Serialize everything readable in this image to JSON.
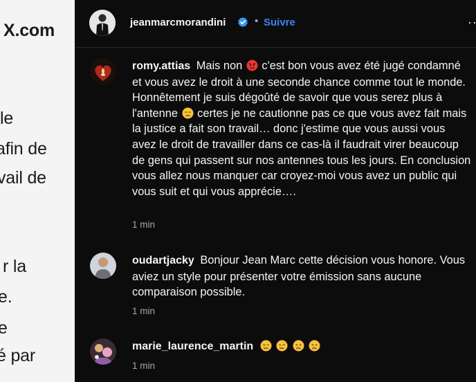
{
  "post_fragments": [
    "X.com",
    "le",
    "afin de",
    "vail de",
    "r la",
    "e.",
    "e",
    "é par"
  ],
  "header": {
    "username": "jeanmarcmorandini",
    "separator": "•",
    "follow_label": "Suivre",
    "more_label": "···"
  },
  "comments": [
    {
      "username": "romy.attias",
      "text_before_emoji": "Mais non",
      "text_after_emoji": "c'est bon vous avez été jugé condamné et vous avez le droit à une seconde chance comme tout le monde. Honnêtement je suis dégoûté de savoir que vous serez plus à l'antenne",
      "text_end": "certes je ne cautionne pas ce que vous avez fait mais la justice a fait son travail… donc j'estime que vous aussi vous avez le droit de travailler dans ce cas-là il faudrait virer beaucoup de gens qui passent sur nos antennes tous les jours. En conclusion vous allez nous manquer car croyez-moi vous avez un public qui vous suit et qui vous apprécie….",
      "time": "1 min"
    },
    {
      "username": "oudartjacky",
      "text": "Bonjour Jean Marc cette décision vous honore. Vous aviez un style pour présenter votre émission sans aucune comparaison possible.",
      "time": "1 min"
    },
    {
      "username": "marie_laurence_martin",
      "time": "1 min"
    }
  ],
  "colors": {
    "panel_bg": "#0c0c0c",
    "text": "#f5f5f5",
    "secondary_text": "#a8a8a8",
    "link_blue": "#3b82f6",
    "post_bg": "#f4f4f4"
  },
  "icons": [
    "verified-badge-icon",
    "angry-face-emoji",
    "sad-face-emoji",
    "crying-face-emoji",
    "more-options-icon"
  ]
}
